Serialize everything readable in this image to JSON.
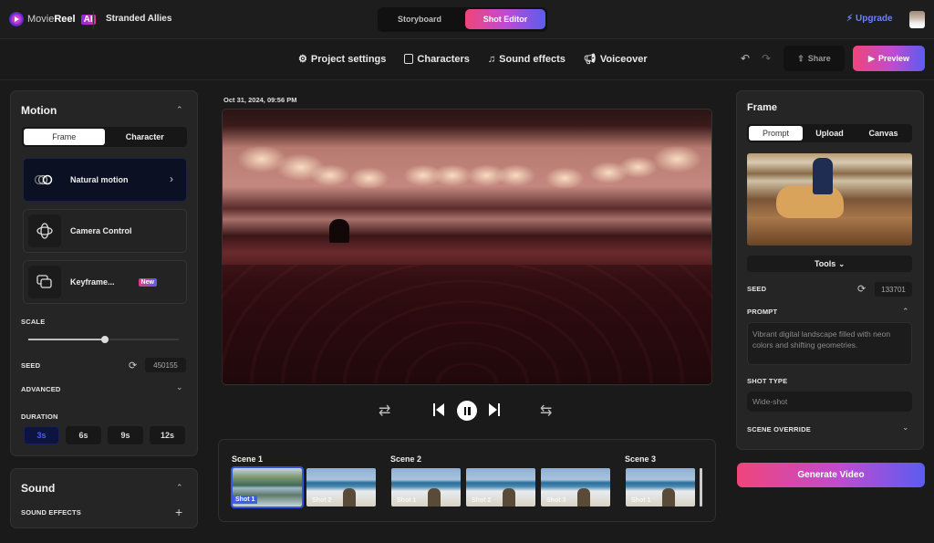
{
  "header": {
    "brand": {
      "name_light": "Movie",
      "name_bold": "Reel",
      "badge": "AI"
    },
    "project_title": "Stranded Allies",
    "modes": [
      {
        "label": "Storyboard",
        "active": false
      },
      {
        "label": "Shot Editor",
        "active": true
      }
    ],
    "upgrade_label": "Upgrade",
    "upgrade_icon": "lightning-icon",
    "avatar_icon": "user-avatar"
  },
  "subnav": {
    "items": [
      {
        "label": "Project settings",
        "icon": "gear-icon"
      },
      {
        "label": "Characters",
        "icon": "person-icon"
      },
      {
        "label": "Sound effects",
        "icon": "music-notes-icon"
      },
      {
        "label": "Voiceover",
        "icon": "megaphone-icon"
      }
    ],
    "undo_icon": "undo-icon",
    "redo_icon": "redo-icon",
    "share_label": "Share",
    "preview_label": "Preview"
  },
  "motion_panel": {
    "title": "Motion",
    "tabs": [
      {
        "label": "Frame",
        "active": true
      },
      {
        "label": "Character",
        "active": false
      }
    ],
    "cards": [
      {
        "label": "Natural motion",
        "icon": "rings-icon",
        "selected": true,
        "has_arrow": true
      },
      {
        "label": "Camera Control",
        "icon": "orbit-icon",
        "selected": false
      },
      {
        "label": "Keyframe...",
        "icon": "frames-icon",
        "selected": false,
        "badge": "New"
      }
    ],
    "scale_label": "SCALE",
    "scale_value": 0.51,
    "seed_label": "SEED",
    "seed_value": "450155",
    "advanced_label": "ADVANCED",
    "duration_label": "DURATION",
    "durations": [
      {
        "label": "3s",
        "active": true
      },
      {
        "label": "6s",
        "active": false
      },
      {
        "label": "9s",
        "active": false
      },
      {
        "label": "12s",
        "active": false
      }
    ]
  },
  "sound_panel": {
    "title": "Sound",
    "sound_effects_label": "SOUND EFFECTS"
  },
  "preview": {
    "timestamp": "Oct 31, 2024, 09:56 PM",
    "description": "Theater auditorium with red seats and wall sconces, single person seated"
  },
  "playback": {
    "shuffle_icon": "shuffle-icon",
    "prev_icon": "skip-previous-icon",
    "pause_icon": "pause-icon",
    "next_icon": "skip-next-icon",
    "repeat_icon": "repeat-icon"
  },
  "timeline": {
    "scenes": [
      {
        "label": "Scene 1",
        "shots": [
          {
            "label": "Shot 1",
            "selected": true,
            "kind": "lake"
          },
          {
            "label": "Shot 2",
            "kind": "beach"
          }
        ]
      },
      {
        "label": "Scene 2",
        "shots": [
          {
            "label": "Shot 1",
            "kind": "beach"
          },
          {
            "label": "Shot 2",
            "kind": "beach"
          },
          {
            "label": "Shot 3",
            "kind": "beach"
          }
        ]
      },
      {
        "label": "Scene 3",
        "shots": [
          {
            "label": "Shot 1",
            "kind": "beach"
          }
        ]
      }
    ]
  },
  "frame_panel": {
    "title": "Frame",
    "tabs": [
      {
        "label": "Prompt",
        "active": true
      },
      {
        "label": "Upload",
        "active": false
      },
      {
        "label": "Canvas",
        "active": false
      }
    ],
    "tools_label": "Tools",
    "seed_label": "SEED",
    "seed_value": "133701",
    "prompt_label": "PROMPT",
    "prompt_text": "Vibrant digital landscape filled with neon colors and shifting geometries.",
    "shot_type_label": "SHOT TYPE",
    "shot_type_value": "Wide-shot",
    "scene_override_label": "SCENE OVERRIDE",
    "generate_label": "Generate Video"
  },
  "colors": {
    "accent_gradient_start": "#f0457a",
    "accent_gradient_end": "#5b5cf0",
    "upgrade_blue": "#6b83f5",
    "selected_duration": "#4a5ff2"
  }
}
